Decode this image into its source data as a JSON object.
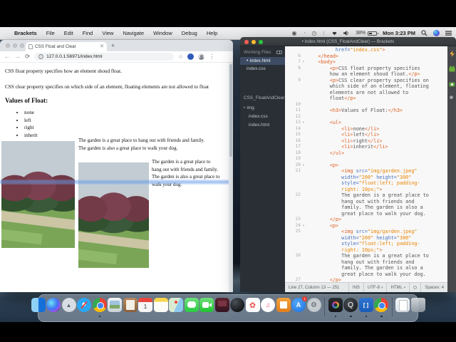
{
  "menu_bar": {
    "app_items": [
      "Brackets",
      "File",
      "Edit",
      "Find",
      "View",
      "Navigate",
      "Window",
      "Debug",
      "Help"
    ],
    "battery_percent": "38%",
    "clock": "Mon 3:23 PM"
  },
  "browser": {
    "tab_title": "CSS Float and Clear",
    "url": "127.0.0.1:56971/index.html",
    "page": {
      "intro1": "CSS float property specifies how an element shoud float.",
      "intro2": "CSS clear property specifies on which side of an element, floating elements are not allowed to float",
      "heading": "Values of Float:",
      "float_values": [
        "none",
        "left",
        "right",
        "inherit"
      ],
      "caption1_lines": [
        "The garden is a great place to hang out with friends and family.",
        "The garden is also a great place to walk your dog."
      ],
      "caption2_lines": [
        "The garden is a great place to",
        "hang out with friends and family.",
        "The garden is also a great place to",
        "walk your dog."
      ]
    }
  },
  "brackets": {
    "window_title": "• index.html (CSS_FloatAndClear) — Brackets",
    "sidebar": {
      "working_files_label": "Working Files",
      "working_files": [
        {
          "name": "index.html",
          "active": true,
          "dirty": true
        },
        {
          "name": "index.css",
          "active": false,
          "dirty": false
        }
      ],
      "project_name": "CSS_FloatAndClear",
      "tree": [
        {
          "name": "img",
          "folder": true
        },
        {
          "name": "index.css",
          "folder": false
        },
        {
          "name": "index.html",
          "folder": false
        }
      ]
    },
    "code": {
      "rows": [
        {
          "n": "",
          "s": [
            [
              "x",
              "          "
            ],
            [
              "a",
              "href="
            ],
            [
              "s",
              "\"index.css\""
            ],
            [
              "t",
              ">"
            ]
          ]
        },
        {
          "n": "6",
          "s": [
            [
              "t",
              "    </head>"
            ]
          ]
        },
        {
          "n": "7",
          "f": 1,
          "s": [
            [
              "t",
              "    <body>"
            ]
          ]
        },
        {
          "n": "8",
          "s": [
            [
              "t",
              "        <p>"
            ],
            [
              "x",
              "CSS float property specifies"
            ]
          ]
        },
        {
          "n": "",
          "s": [
            [
              "x",
              "        how an element shoud float."
            ],
            [
              "t",
              "</p>"
            ]
          ]
        },
        {
          "n": "9",
          "s": [
            [
              "t",
              "        <p>"
            ],
            [
              "x",
              "CSS clear property specifies on"
            ]
          ]
        },
        {
          "n": "",
          "s": [
            [
              "x",
              "        which side of an element, floating"
            ]
          ]
        },
        {
          "n": "",
          "s": [
            [
              "x",
              "        elements are not allowed to"
            ]
          ]
        },
        {
          "n": "",
          "s": [
            [
              "x",
              "        float"
            ],
            [
              "t",
              "</p>"
            ]
          ]
        },
        {
          "n": "10",
          "s": []
        },
        {
          "n": "11",
          "s": [
            [
              "t",
              "        <h3>"
            ],
            [
              "x",
              "Values of Float:"
            ],
            [
              "t",
              "</h3>"
            ]
          ]
        },
        {
          "n": "12",
          "s": []
        },
        {
          "n": "13",
          "f": 1,
          "s": [
            [
              "t",
              "        <ul>"
            ]
          ]
        },
        {
          "n": "14",
          "s": [
            [
              "t",
              "            <li>"
            ],
            [
              "x",
              "none"
            ],
            [
              "t",
              "</li>"
            ]
          ]
        },
        {
          "n": "15",
          "s": [
            [
              "t",
              "            <li>"
            ],
            [
              "x",
              "left"
            ],
            [
              "t",
              "</li>"
            ]
          ]
        },
        {
          "n": "16",
          "s": [
            [
              "t",
              "            <li>"
            ],
            [
              "x",
              "right"
            ],
            [
              "t",
              "</li>"
            ]
          ]
        },
        {
          "n": "17",
          "s": [
            [
              "t",
              "            <li>"
            ],
            [
              "x",
              "inherit"
            ],
            [
              "t",
              "</li>"
            ]
          ]
        },
        {
          "n": "18",
          "s": [
            [
              "t",
              "        </ul>"
            ]
          ]
        },
        {
          "n": "19",
          "s": []
        },
        {
          "n": "20",
          "f": 1,
          "s": [
            [
              "t",
              "        <p>"
            ]
          ]
        },
        {
          "n": "21",
          "s": [
            [
              "t",
              "            <img "
            ],
            [
              "a",
              "src="
            ],
            [
              "s",
              "\"img/garden.jpeg\""
            ]
          ]
        },
        {
          "n": "",
          "s": [
            [
              "x",
              "            "
            ],
            [
              "a",
              "width="
            ],
            [
              "s",
              "\"200\""
            ],
            [
              "x",
              " "
            ],
            [
              "a",
              "height="
            ],
            [
              "s",
              "\"300\""
            ]
          ]
        },
        {
          "n": "",
          "s": [
            [
              "x",
              "            "
            ],
            [
              "a",
              "style="
            ],
            [
              "s",
              "\"float:left; padding-"
            ]
          ]
        },
        {
          "n": "",
          "s": [
            [
              "s",
              "            right: 10px;\""
            ],
            [
              "t",
              ">"
            ]
          ]
        },
        {
          "n": "22",
          "s": [
            [
              "x",
              "            The garden is a great place to"
            ]
          ]
        },
        {
          "n": "",
          "s": [
            [
              "x",
              "            hang out with friends and"
            ]
          ]
        },
        {
          "n": "",
          "s": [
            [
              "x",
              "            family. The garden is also a"
            ]
          ]
        },
        {
          "n": "",
          "s": [
            [
              "x",
              "            great place to walk your dog."
            ]
          ]
        },
        {
          "n": "23",
          "s": [
            [
              "t",
              "        </p>"
            ]
          ]
        },
        {
          "n": "24",
          "f": 1,
          "s": [
            [
              "t",
              "        <p>"
            ]
          ]
        },
        {
          "n": "25",
          "s": [
            [
              "t",
              "            <img "
            ],
            [
              "a",
              "src="
            ],
            [
              "s",
              "\"img/garden.jpeg\""
            ]
          ]
        },
        {
          "n": "",
          "s": [
            [
              "x",
              "            "
            ],
            [
              "a",
              "width="
            ],
            [
              "s",
              "\"200\""
            ],
            [
              "x",
              " "
            ],
            [
              "a",
              "height="
            ],
            [
              "s",
              "\"300\""
            ]
          ]
        },
        {
          "n": "",
          "s": [
            [
              "x",
              "            "
            ],
            [
              "a",
              "style="
            ],
            [
              "s",
              "\"float:left; padding-"
            ]
          ]
        },
        {
          "n": "",
          "s": [
            [
              "s",
              "            right: 10px;\""
            ],
            [
              "t",
              ">"
            ]
          ]
        },
        {
          "n": "26",
          "s": [
            [
              "x",
              "            The garden is a great place to"
            ]
          ]
        },
        {
          "n": "",
          "s": [
            [
              "x",
              "            hang out with friends and"
            ]
          ]
        },
        {
          "n": "",
          "s": [
            [
              "x",
              "            family. The garden is also a"
            ]
          ]
        },
        {
          "n": "",
          "s": [
            [
              "x",
              "            great place to walk your dog."
            ]
          ]
        },
        {
          "n": "27",
          "s": [
            [
              "t",
              "        </p>"
            ]
          ]
        }
      ]
    },
    "status": {
      "cursor": "Line 27, Column 13 — 251",
      "overwrite": "INS",
      "encoding": "UTF-8",
      "language": "HTML",
      "spaces": "Spaces: 4"
    }
  },
  "dock": {
    "items": [
      {
        "name": "finder"
      },
      {
        "name": "siri"
      },
      {
        "name": "launchpad",
        "glyph": "▲"
      },
      {
        "name": "safari"
      },
      {
        "name": "chrome",
        "running": true
      },
      {
        "name": "preview"
      },
      {
        "name": "contacts"
      },
      {
        "name": "calendar",
        "glyph": "1"
      },
      {
        "name": "notes"
      },
      {
        "name": "maps"
      },
      {
        "name": "messages"
      },
      {
        "name": "facetime"
      },
      {
        "name": "photo-booth"
      },
      {
        "name": "chess"
      },
      {
        "name": "photos",
        "glyph": "✿"
      },
      {
        "name": "itunes",
        "glyph": "♫"
      },
      {
        "name": "ibooks"
      },
      {
        "name": "app-store",
        "badge": "1"
      },
      {
        "name": "system-preferences",
        "glyph": "⚙"
      },
      {
        "name": "separator"
      },
      {
        "name": "screen-recorder-app",
        "running": true
      },
      {
        "name": "quicktime",
        "glyph": "Q",
        "running": true
      },
      {
        "name": "brackets",
        "glyph": "[]",
        "running": true
      },
      {
        "name": "chromium",
        "running": true
      },
      {
        "name": "separator"
      },
      {
        "name": "downloads"
      },
      {
        "name": "trash"
      }
    ]
  },
  "colors": {
    "accent_blue": "#446fbd",
    "tag_orange": "#dd5c1e",
    "string_orange": "#e88501",
    "highlight_band": "#6096e6"
  }
}
